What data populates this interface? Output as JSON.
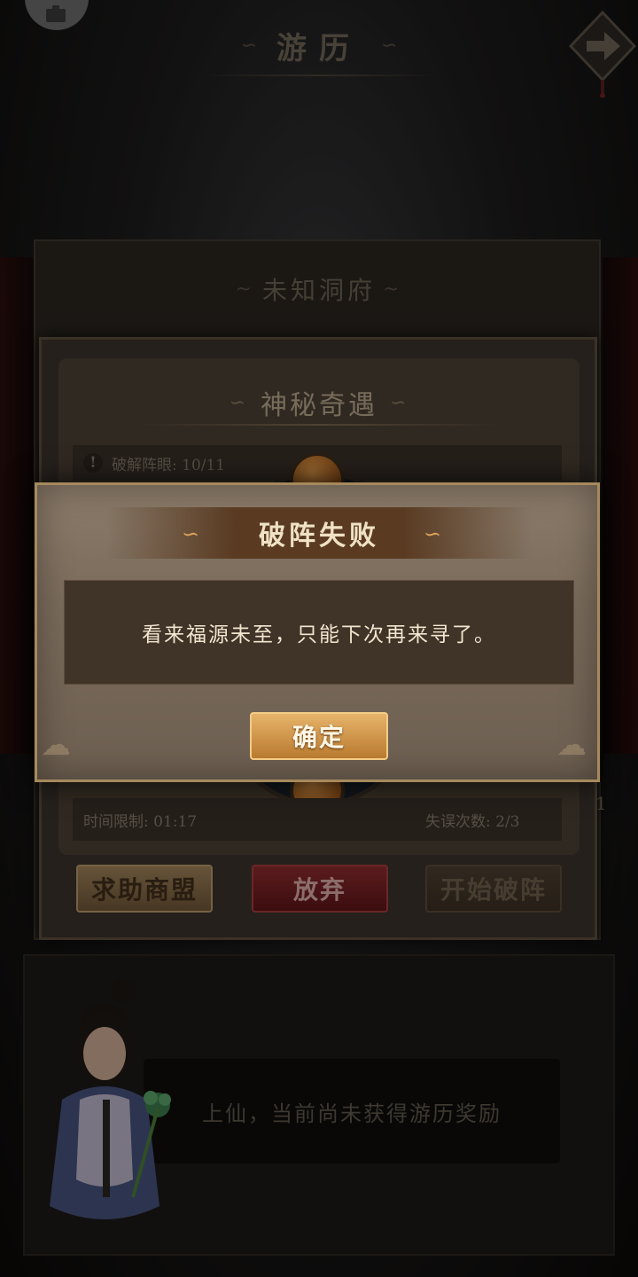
{
  "header": {
    "title": "游历"
  },
  "background_panel": {
    "title": "未知洞府"
  },
  "event_panel": {
    "title": "神秘奇遇",
    "progress_label": "破解阵眼: 10/11",
    "time_limit_label": "时间限制: 01:17",
    "mistakes_label": "失误次数: 2/3",
    "side_count": "1",
    "buttons": {
      "help": "求助商盟",
      "quit": "放弃",
      "start": "开始破阵"
    }
  },
  "bottom_panel": {
    "message": "上仙，当前尚未获得游历奖励"
  },
  "modal": {
    "title": "破阵失败",
    "message": "看来福源未至，只能下次再来寻了。",
    "confirm": "确定"
  },
  "colors": {
    "modal_gold": "#a68a5d",
    "confirm_button": "#d9a25a",
    "quit_button": "#8e2b2e"
  },
  "icons": [
    "plugin-icon",
    "arrow-right-icon",
    "warning-icon"
  ]
}
